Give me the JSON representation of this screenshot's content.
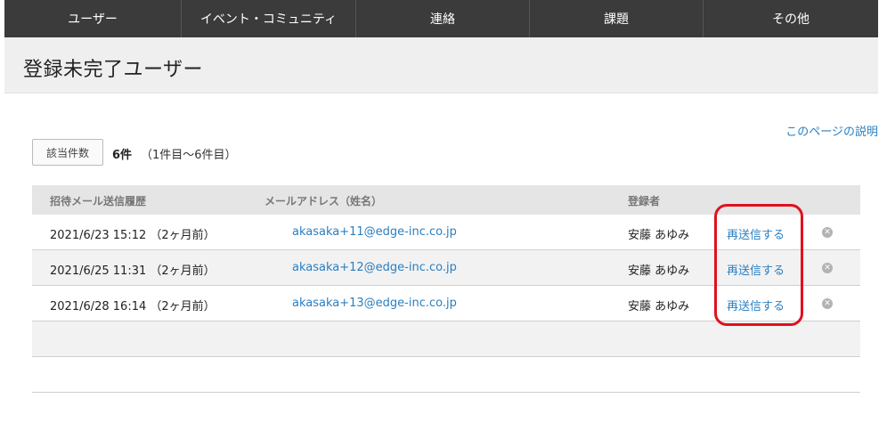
{
  "nav": {
    "items": [
      "ユーザー",
      "イベント・コミュニティ",
      "連絡",
      "課題",
      "その他"
    ]
  },
  "page": {
    "title": "登録未完了ユーザー",
    "help_link": "このページの説明"
  },
  "summary": {
    "label": "該当件数",
    "count": "6件",
    "range": "（1件目〜6件目）"
  },
  "table": {
    "headers": {
      "history": "招待メール送信履歴",
      "email": "メールアドレス（姓名）",
      "registrant": "登録者"
    },
    "rows": [
      {
        "date": "2021/6/23 15:12 （2ヶ月前）",
        "email": "akasaka+11@edge-inc.co.jp",
        "registrant": "安藤 あゆみ",
        "resend": "再送信する"
      },
      {
        "date": "2021/6/25 11:31 （2ヶ月前）",
        "email": "akasaka+12@edge-inc.co.jp",
        "registrant": "安藤 あゆみ",
        "resend": "再送信する"
      },
      {
        "date": "2021/6/28 16:14 （2ヶ月前）",
        "email": "akasaka+13@edge-inc.co.jp",
        "registrant": "安藤 あゆみ",
        "resend": "再送信する"
      }
    ],
    "delete_icon": "close-circle-icon"
  },
  "colors": {
    "nav_bg": "#3b3b3b",
    "link": "#2a7fc1",
    "highlight": "#e0111d"
  }
}
